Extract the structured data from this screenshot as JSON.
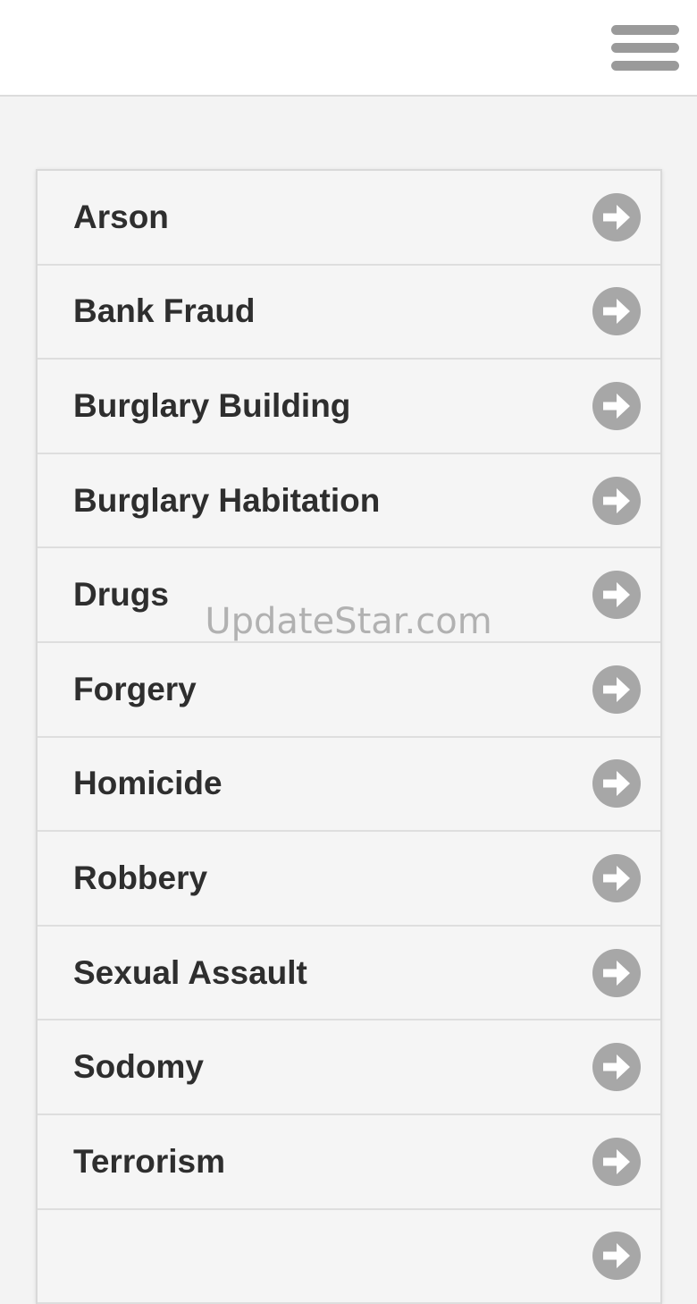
{
  "header": {
    "menu_icon": "hamburger-menu-icon"
  },
  "list": {
    "item_icon": "arrow-right-circle-icon",
    "items": [
      {
        "label": "Arson"
      },
      {
        "label": "Bank Fraud"
      },
      {
        "label": "Burglary Building"
      },
      {
        "label": "Burglary Habitation"
      },
      {
        "label": "Drugs"
      },
      {
        "label": "Forgery"
      },
      {
        "label": "Homicide"
      },
      {
        "label": "Robbery"
      },
      {
        "label": "Sexual Assault"
      },
      {
        "label": "Sodomy"
      },
      {
        "label": "Terrorism"
      },
      {
        "label": ""
      }
    ]
  },
  "watermark": {
    "text": "UpdateStar.com"
  },
  "colors": {
    "header_bg": "#ffffff",
    "page_bg": "#f3f3f3",
    "item_bg": "#f5f5f5",
    "label_text": "#2e2e2e",
    "icon_gray": "#a7a7a7"
  }
}
